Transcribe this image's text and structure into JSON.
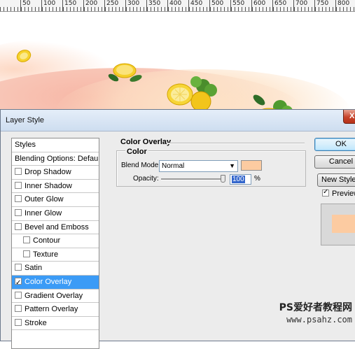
{
  "ruler": {
    "marks": [
      "50",
      "100",
      "150",
      "200",
      "250",
      "300",
      "350",
      "400",
      "450",
      "500",
      "550",
      "600",
      "650",
      "700",
      "750",
      "800"
    ]
  },
  "dialog": {
    "title": "Layer Style",
    "close_label": "X",
    "styles_header": "Styles",
    "blending_label": "Blending Options: Default",
    "items": [
      {
        "label": "Drop Shadow",
        "checked": false,
        "sub": false,
        "selected": false
      },
      {
        "label": "Inner Shadow",
        "checked": false,
        "sub": false,
        "selected": false
      },
      {
        "label": "Outer Glow",
        "checked": false,
        "sub": false,
        "selected": false
      },
      {
        "label": "Inner Glow",
        "checked": false,
        "sub": false,
        "selected": false
      },
      {
        "label": "Bevel and Emboss",
        "checked": false,
        "sub": false,
        "selected": false
      },
      {
        "label": "Contour",
        "checked": false,
        "sub": true,
        "selected": false
      },
      {
        "label": "Texture",
        "checked": false,
        "sub": true,
        "selected": false
      },
      {
        "label": "Satin",
        "checked": false,
        "sub": false,
        "selected": false
      },
      {
        "label": "Color Overlay",
        "checked": true,
        "sub": false,
        "selected": true
      },
      {
        "label": "Gradient Overlay",
        "checked": false,
        "sub": false,
        "selected": false
      },
      {
        "label": "Pattern Overlay",
        "checked": false,
        "sub": false,
        "selected": false
      },
      {
        "label": "Stroke",
        "checked": false,
        "sub": false,
        "selected": false
      }
    ],
    "section_title": "Color Overlay",
    "subsection_title": "Color",
    "blend_mode_label": "Blend Mode:",
    "blend_mode_value": "Normal",
    "overlay_color": "#fccba1",
    "opacity_label": "Opacity:",
    "opacity_value": "100",
    "opacity_unit": "%",
    "ok_label": "OK",
    "cancel_label": "Cancel",
    "new_style_label": "New Style...",
    "preview_label": "Preview",
    "preview_checked": true
  },
  "watermark": {
    "line1": "PS爱好者教程网",
    "line2": "www.psahz.com"
  }
}
